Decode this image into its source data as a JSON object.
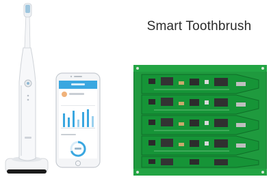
{
  "caption": {
    "title": "Smart Toothbrush"
  },
  "images": {
    "product_photo": {
      "subject": "white electric toothbrush in charging stand beside a smartphone showing the companion app"
    },
    "pcb_photo": {
      "subject": "green printed circuit board panel with five toothbrush control boards"
    }
  },
  "colors": {
    "pcb_green": "#1f9a3e",
    "pcb_dark": "#147a2c",
    "app_blue": "#3aa7e0",
    "toothbrush_white": "#f4f6f8"
  }
}
